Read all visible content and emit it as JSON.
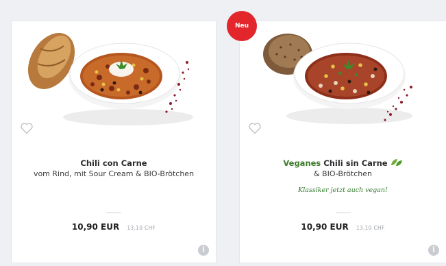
{
  "products": [
    {
      "title_main": "Chili con Carne",
      "title_accent": "",
      "subtitle": "vom Rind, mit Sour Cream & BIO-Brötchen",
      "tagline": "",
      "price": "10,90 EUR",
      "price_chf": "13,10 CHF",
      "favorite_icon": "heart-outline-icon",
      "info_icon": "info-icon",
      "info_glyph": "i"
    },
    {
      "title_main": "Chili sin Carne",
      "title_accent": "Veganes",
      "subtitle": "& BIO-Brötchen",
      "tagline": "Klassiker jetzt auch vegan!",
      "price": "10,90 EUR",
      "price_chf": "13,10 CHF",
      "badge": "Neu",
      "favorite_icon": "heart-outline-icon",
      "info_icon": "info-icon",
      "info_glyph": "i",
      "vegan_icon": "leaf-icon"
    }
  ],
  "colors": {
    "accent_green": "#3d7a2a",
    "badge_red": "#e3262b",
    "background": "#eef0f3"
  }
}
